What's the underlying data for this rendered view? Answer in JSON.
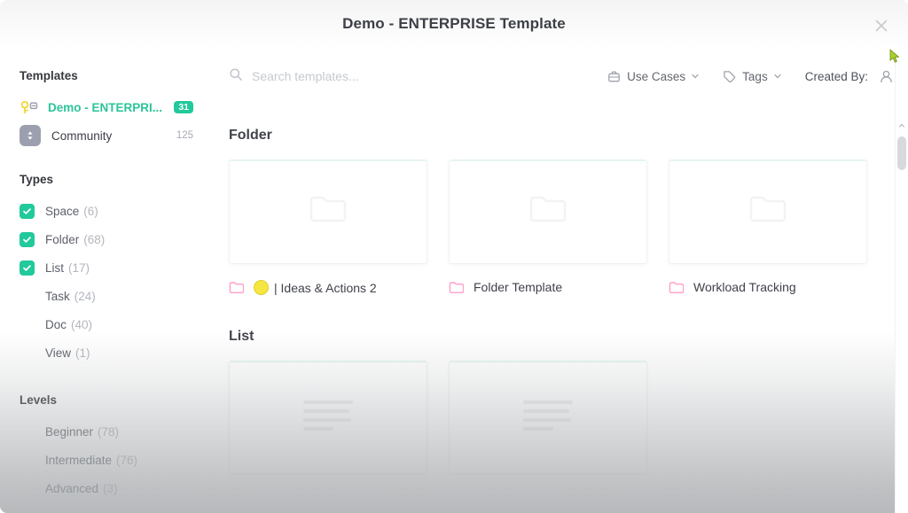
{
  "window": {
    "title": "Demo - ENTERPRISE Template",
    "close_label": "close-icon"
  },
  "colors": {
    "accent_green": "#22c99b",
    "accent_green_text": "#2bc49a",
    "folder_pink": "#ff9ec8",
    "emoji_yellow": "#f5e642",
    "text_primary": "#3c3f46",
    "text_muted": "#b3b6bd"
  },
  "sidebar": {
    "templates_heading": "Templates",
    "sources": [
      {
        "label": "Demo - ENTERPRI...",
        "badge": "31",
        "icon": "key-icon",
        "active": true
      },
      {
        "label": "Community",
        "count": "125",
        "icon": "community-icon",
        "active": false
      }
    ],
    "types_heading": "Types",
    "types": [
      {
        "label": "Space",
        "count": "(6)",
        "checked": true
      },
      {
        "label": "Folder",
        "count": "(68)",
        "checked": true
      },
      {
        "label": "List",
        "count": "(17)",
        "checked": true
      },
      {
        "label": "Task",
        "count": "(24)",
        "checked": false
      },
      {
        "label": "Doc",
        "count": "(40)",
        "checked": false
      },
      {
        "label": "View",
        "count": "(1)",
        "checked": false
      }
    ],
    "levels_heading": "Levels",
    "levels": [
      {
        "label": "Beginner",
        "count": "(78)",
        "checked": false
      },
      {
        "label": "Intermediate",
        "count": "(76)",
        "checked": false
      },
      {
        "label": "Advanced",
        "count": "(3)",
        "checked": false
      }
    ]
  },
  "toolbar": {
    "search_placeholder": "Search templates...",
    "search_value": "",
    "use_cases_label": "Use Cases",
    "tags_label": "Tags",
    "created_by_label": "Created By:"
  },
  "results": {
    "groups": [
      {
        "title": "Folder",
        "cards": [
          {
            "label": "| Ideas & Actions 2",
            "emoji": true,
            "thumb": "folder-glyph"
          },
          {
            "label": "Folder Template",
            "emoji": false,
            "thumb": "folder-glyph"
          },
          {
            "label": "Workload Tracking",
            "emoji": false,
            "thumb": "folder-glyph"
          }
        ]
      },
      {
        "title": "List",
        "cards": [
          {
            "label": "",
            "emoji": false,
            "thumb": "list-glyph"
          },
          {
            "label": "",
            "emoji": false,
            "thumb": "list-glyph"
          }
        ]
      }
    ]
  }
}
